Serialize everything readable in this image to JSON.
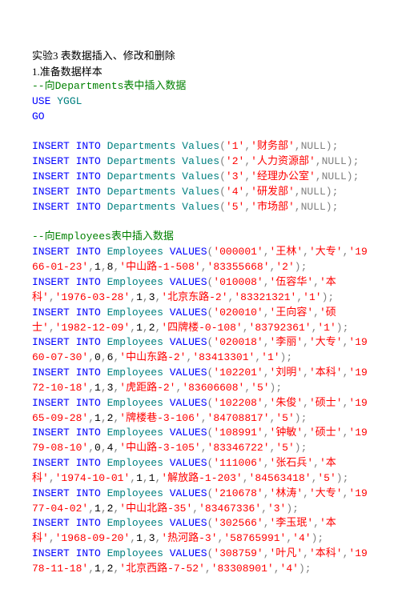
{
  "heading": "实验3 表数据插入、修改和删除",
  "subheading": "1.准备数据样本",
  "comment1": "--向Departments表中插入数据",
  "use_kw": "USE",
  "use_db": "YGGL",
  "go": "GO",
  "dept_rows": [
    {
      "id": "'1'",
      "name": "'财务部'"
    },
    {
      "id": "'2'",
      "name": "'人力资源部'"
    },
    {
      "id": "'3'",
      "name": "'经理办公室'"
    },
    {
      "id": "'4'",
      "name": "'研发部'"
    },
    {
      "id": "'5'",
      "name": "'市场部'"
    }
  ],
  "comment2": "--向Employees表中插入数据",
  "emp_rows": [
    {
      "line": "INSERT INTO Employees VALUES('000001','王林','大专','1966-01-23',1,8,'中山路-1-508','83355668','2');"
    },
    {
      "line": "INSERT INTO Employees VALUES('010008','伍容华','本科','1976-03-28',1,3,'北京东路-2','83321321','1');"
    },
    {
      "line": "INSERT INTO Employees VALUES('020010','王向容','硕士','1982-12-09',1,2,'四牌楼-0-108','83792361','1');"
    },
    {
      "line": "INSERT INTO Employees VALUES('020018','李丽','大专','1960-07-30',0,6,'中山东路-2','83413301','1');"
    },
    {
      "line": "INSERT INTO Employees VALUES('102201','刘明','本科','1972-10-18',1,3,'虎距路-2','83606608','5');"
    },
    {
      "line": "INSERT INTO Employees VALUES('102208','朱俊','硕士','1965-09-28',1,2,'牌楼巷-3-106','84708817','5');"
    },
    {
      "line": "INSERT INTO Employees VALUES('108991','钟敏','硕士','1979-08-10',0,4,'中山路-3-105','83346722','5');"
    },
    {
      "line": "INSERT INTO Employees VALUES('111006','张石兵','本科','1974-10-01',1,1,'解放路-1-203','84563418','5');"
    },
    {
      "line": "INSERT INTO Employees VALUES('210678','林涛','大专','1977-04-02',1,2,'中山北路-35','83467336','3');"
    },
    {
      "line": "INSERT INTO Employees VALUES('302566','李玉珉','本科','1968-09-20',1,3,'热河路-3','58765991','4');"
    },
    {
      "line": "INSERT INTO Employees VALUES('308759','叶凡','本科','1978-11-18',1,2,'北京西路-7-52','83308901','4');"
    }
  ]
}
